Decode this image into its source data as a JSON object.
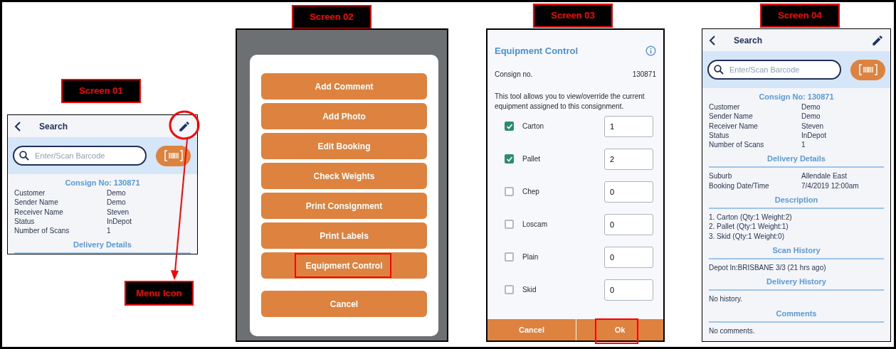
{
  "screens": [
    {
      "label": "Screen 01",
      "kind": "search",
      "title": "Search",
      "search_placeholder": "Enter/Scan Barcode",
      "consign_heading": "Consign No: 130871",
      "details": [
        {
          "name": "Customer",
          "value": "Demo"
        },
        {
          "name": "Sender Name",
          "value": "Demo"
        },
        {
          "name": "Receiver Name",
          "value": "Steven"
        },
        {
          "name": "Status",
          "value": "InDepot"
        },
        {
          "name": "Number of Scans",
          "value": "1"
        }
      ],
      "sections": [
        {
          "heading": "Delivery Details"
        }
      ]
    },
    {
      "label": "Screen 02",
      "kind": "menu",
      "buttons": [
        {
          "label": "Add Comment",
          "highlighted": false
        },
        {
          "label": "Add Photo",
          "highlighted": false
        },
        {
          "label": "Edit Booking",
          "highlighted": false
        },
        {
          "label": "Check Weights",
          "highlighted": false
        },
        {
          "label": "Print Consignment",
          "highlighted": false
        },
        {
          "label": "Print Labels",
          "highlighted": false
        },
        {
          "label": "Equipment Control",
          "highlighted": true
        }
      ],
      "cancel": "Cancel"
    },
    {
      "label": "Screen 03",
      "kind": "equipment",
      "title": "Equipment Control",
      "consign_label": "Consign no.",
      "consign_value": "130871",
      "description": "This tool allows you to view/override the current equipment assigned to this consignment.",
      "items": [
        {
          "name": "Carton",
          "checked": true,
          "value": "1"
        },
        {
          "name": "Pallet",
          "checked": true,
          "value": "2"
        },
        {
          "name": "Chep",
          "checked": false,
          "value": "0"
        },
        {
          "name": "Loscam",
          "checked": false,
          "value": "0"
        },
        {
          "name": "Plain",
          "checked": false,
          "value": "0"
        },
        {
          "name": "Skid",
          "checked": false,
          "value": "0"
        }
      ],
      "buttons": [
        {
          "label": "Cancel",
          "highlighted": false
        },
        {
          "label": "Ok",
          "highlighted": true
        }
      ]
    },
    {
      "label": "Screen 04",
      "kind": "search",
      "title": "Search",
      "search_placeholder": "Enter/Scan Barcode",
      "consign_heading": "Consign No: 130871",
      "details": [
        {
          "name": "Customer",
          "value": "Demo"
        },
        {
          "name": "Sender Name",
          "value": "Demo"
        },
        {
          "name": "Receiver Name",
          "value": "Steven"
        },
        {
          "name": "Status",
          "value": "InDepot"
        },
        {
          "name": "Number of Scans",
          "value": "1"
        }
      ],
      "sections": [
        {
          "heading": "Delivery Details",
          "rows": [
            {
              "name": "Suburb",
              "value": "Allendale East"
            },
            {
              "name": "Booking Date/Time",
              "value": "7/4/2019 12:00am"
            }
          ]
        },
        {
          "heading": "Description",
          "lines": [
            "1. Carton (Qty:1 Weight:2)",
            "2. Pallet (Qty:1 Weight:1)",
            "3. Skid (Qty:1 Weight:0)"
          ]
        },
        {
          "heading": "Scan History",
          "lines": [
            "Depot In:BRISBANE 3/3 (21 hrs ago)"
          ]
        },
        {
          "heading": "Delivery History",
          "lines": [
            "No history."
          ]
        },
        {
          "heading": "Comments",
          "lines": [
            "No comments."
          ]
        }
      ]
    }
  ],
  "callout": {
    "label": "Menu Icon"
  }
}
